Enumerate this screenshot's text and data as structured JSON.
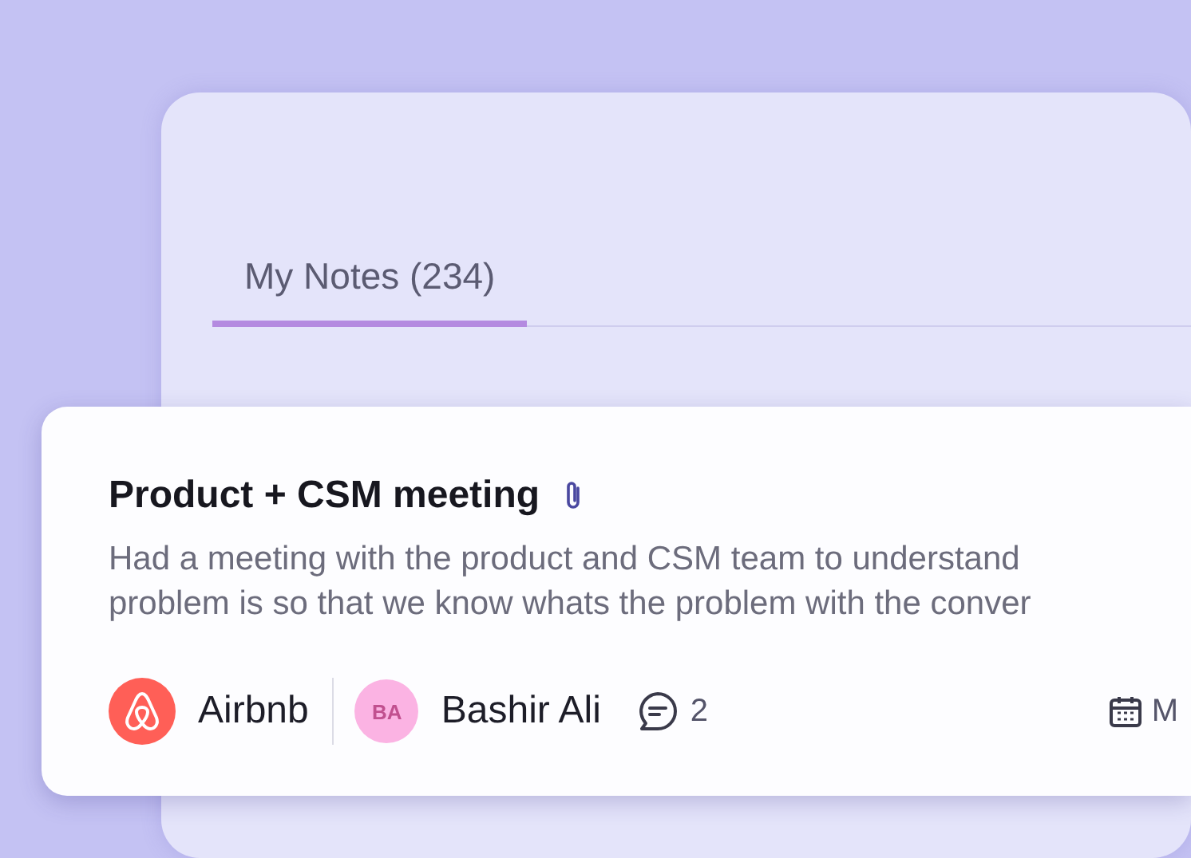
{
  "tabs": [
    {
      "label": "My Notes (234)",
      "selected": true
    }
  ],
  "featured_note": {
    "title": "Product + CSM meeting",
    "attachment": true,
    "description_lines": [
      "Had a meeting with the product and CSM team to understand",
      "problem is so that we know whats the problem with the conver"
    ],
    "company": "Airbnb",
    "owner": {
      "initials": "BA",
      "name": "Bashir Ali"
    },
    "comments": "2",
    "date": "M"
  }
}
